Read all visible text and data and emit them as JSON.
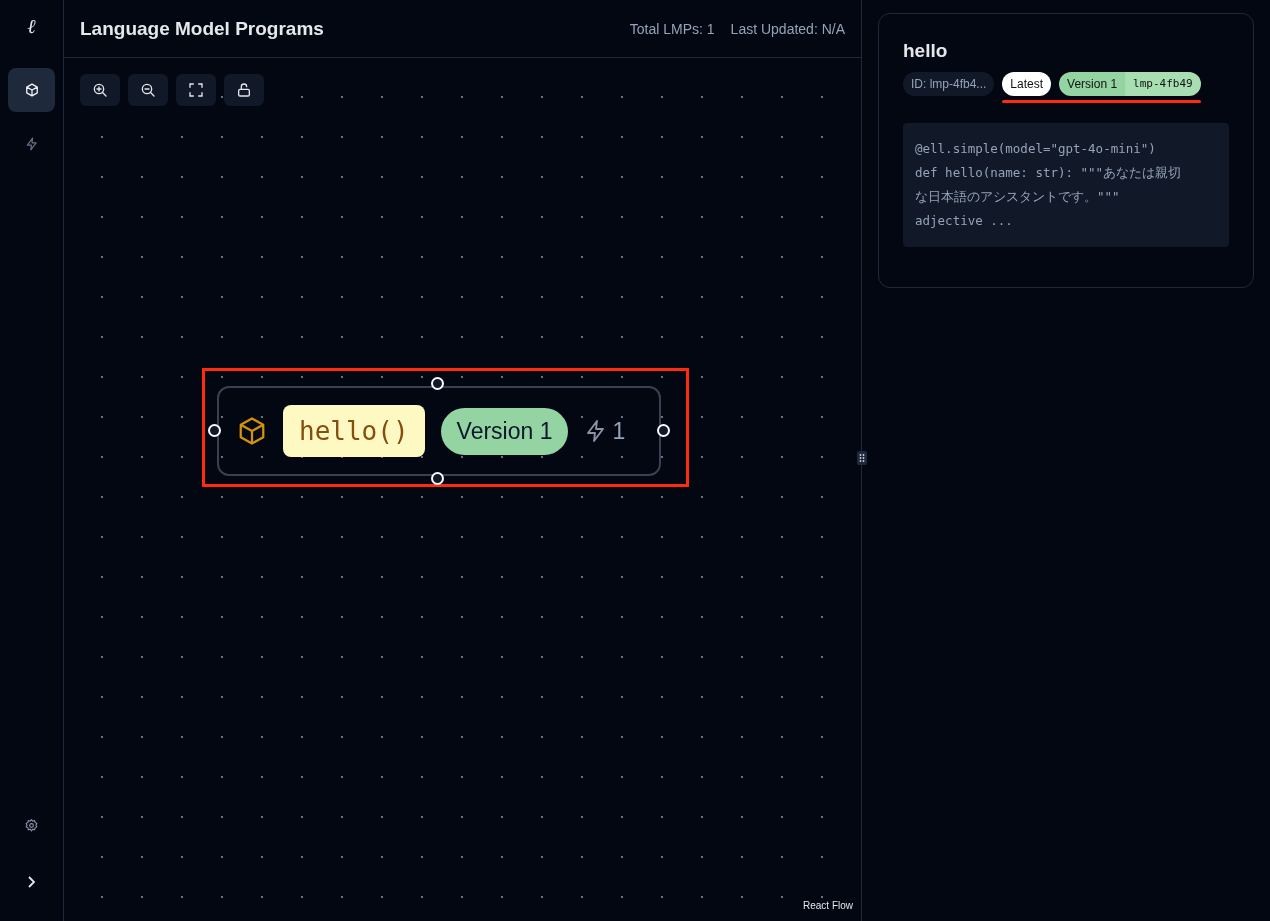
{
  "sidebar": {
    "logo": "ℓ",
    "items": [
      {
        "kind": "cube",
        "selected": true
      },
      {
        "kind": "bolt",
        "selected": false
      }
    ],
    "bottom": [
      {
        "kind": "settings"
      },
      {
        "kind": "expand"
      }
    ]
  },
  "header": {
    "title": "Language Model Programs",
    "stats": [
      "Total LMPs: 1",
      "Last Updated: N/A"
    ]
  },
  "toolbar": [
    {
      "kind": "zoom-in"
    },
    {
      "kind": "zoom-out"
    },
    {
      "kind": "fit"
    },
    {
      "kind": "lock",
      "locked": false
    }
  ],
  "node": {
    "name": "hello()",
    "version": "Version 1",
    "invocations": "1"
  },
  "attribution": "React Flow",
  "detail": {
    "title": "hello",
    "id": "ID: lmp-4fb4...",
    "latest": "Latest",
    "version": "Version 1",
    "hash": "lmp-4fb49",
    "code": [
      "@ell.simple(model=\"gpt-4o-mini\")",
      "def hello(name: str): \"\"\"あなたは親切",
      "な日本語のアシスタントです。\"\"\"",
      "adjective ..."
    ]
  }
}
